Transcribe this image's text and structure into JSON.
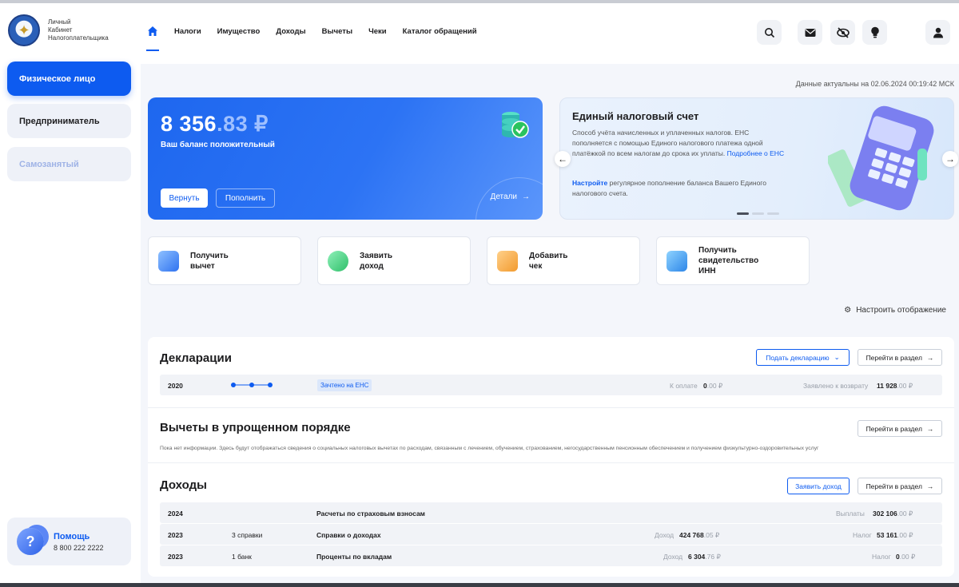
{
  "brand": {
    "line1": "Личный",
    "line2": "Кабинет",
    "line3": "Налогоплательщика"
  },
  "sidebar": {
    "items": [
      {
        "label": "Физическое лицо"
      },
      {
        "label": "Предприниматель"
      },
      {
        "label": "Самозанятый"
      }
    ],
    "help": {
      "title": "Помощь",
      "phone": "8 800 222 2222"
    }
  },
  "nav": {
    "items": [
      "Налоги",
      "Имущество",
      "Доходы",
      "Вычеты",
      "Чеки",
      "Каталог обращений"
    ]
  },
  "actual_text": "Данные актуальны на 02.06.2024 00:19:42 МСК",
  "balance": {
    "amount_main": "8 356",
    "amount_cents": ".83 ₽",
    "status": "Ваш баланс положительный",
    "return_label": "Вернуть",
    "topup_label": "Пополнить",
    "details_label": "Детали"
  },
  "ens": {
    "title": "Единый налоговый счет",
    "text": "Способ учёта начисленных и уплаченных налогов. ЕНС пополняется с помощью Единого налогового платежа одной платёжкой по всем налогам до срока их уплаты.",
    "link": "Подробнее о ЕНС",
    "text2_link": "Настройте",
    "text2": " регулярное пополнение баланса Вашего Единого налогового счета."
  },
  "quick_actions": [
    {
      "label": "Получить\nвычет"
    },
    {
      "label": "Заявить\nдоход"
    },
    {
      "label": "Добавить\nчек"
    },
    {
      "label": "Получить\nсвидетельство\nИНН"
    }
  ],
  "configure_label": "Настроить отображение",
  "declarations": {
    "title": "Декларации",
    "submit_label": "Подать декларацию",
    "goto_label": "Перейти в раздел",
    "row": {
      "year": "2020",
      "badge": "Зачтено на ЕНС",
      "pay_label": "К оплате",
      "pay_main": "0",
      "pay_cents": ".00 ₽",
      "refund_label": "Заявлено к возврату",
      "refund_main": "11 928",
      "refund_cents": ".00 ₽"
    }
  },
  "deductions": {
    "title": "Вычеты в упрощенном порядке",
    "goto_label": "Перейти в раздел",
    "note": "Пока нет информации. Здесь будут отображаться сведения о социальных налоговых вычетах по расходам, связанным с лечением, обучением, страхованием, негосударственным пенсионным обеспечением и получением физкультурно-оздоровительных услуг"
  },
  "income": {
    "title": "Доходы",
    "declare_label": "Заявить доход",
    "goto_label": "Перейти в раздел",
    "rows": [
      {
        "year": "2024",
        "count": "",
        "name": "Расчеты по страховым взносам",
        "income_label": "",
        "income_main": "",
        "income_cents": "",
        "right_label": "Выплаты",
        "right_main": "302 106",
        "right_cents": ".00 ₽"
      },
      {
        "year": "2023",
        "count": "3 справки",
        "name": "Справки о доходах",
        "income_label": "Доход",
        "income_main": "424 768",
        "income_cents": ".05 ₽",
        "right_label": "Налог",
        "right_main": "53 161",
        "right_cents": ".00 ₽"
      },
      {
        "year": "2023",
        "count": "1 банк",
        "name": "Проценты по вкладам",
        "income_label": "Доход",
        "income_main": "6 304",
        "income_cents": ".76 ₽",
        "right_label": "Налог",
        "right_main": "0",
        "right_cents": ".00 ₽"
      }
    ]
  }
}
